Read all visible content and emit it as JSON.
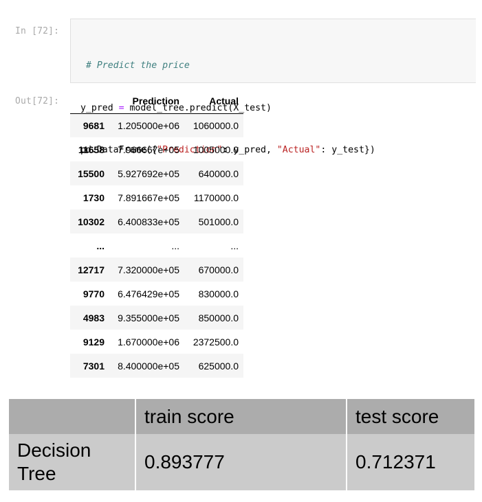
{
  "input_prompt": "In [72]:",
  "output_prompt": "Out[72]:",
  "code": {
    "comment": "# Predict the price",
    "line2": {
      "a": "y_pred ",
      "op": "=",
      "b": " model_tree.predict(X_test)"
    },
    "line3": {
      "a": "pd.DataFrame({",
      "s1": "\"Prediction\"",
      "b": ": y_pred, ",
      "s2": "\"Actual\"",
      "c": ": y_test})"
    }
  },
  "dataframe": {
    "columns": [
      "",
      "Prediction",
      "Actual"
    ],
    "rows": [
      {
        "index": "9681",
        "prediction": "1.205000e+06",
        "actual": "1060000.0"
      },
      {
        "index": "11658",
        "prediction": "7.966667e+05",
        "actual": "1005000.0"
      },
      {
        "index": "15500",
        "prediction": "5.927692e+05",
        "actual": "640000.0"
      },
      {
        "index": "1730",
        "prediction": "7.891667e+05",
        "actual": "1170000.0"
      },
      {
        "index": "10302",
        "prediction": "6.400833e+05",
        "actual": "501000.0"
      },
      {
        "index": "...",
        "prediction": "...",
        "actual": "..."
      },
      {
        "index": "12717",
        "prediction": "7.320000e+05",
        "actual": "670000.0"
      },
      {
        "index": "9770",
        "prediction": "6.476429e+05",
        "actual": "830000.0"
      },
      {
        "index": "4983",
        "prediction": "9.355000e+05",
        "actual": "850000.0"
      },
      {
        "index": "9129",
        "prediction": "1.670000e+06",
        "actual": "2372500.0"
      },
      {
        "index": "7301",
        "prediction": "8.400000e+05",
        "actual": "625000.0"
      }
    ]
  },
  "score_table": {
    "headers": [
      "",
      "train score",
      "test score"
    ],
    "model": "Decision Tree",
    "train": "0.893777",
    "test": "0.712371"
  },
  "colors": {
    "code_bg": "#f7f7f7",
    "comment": "#408080",
    "operator": "#aa22ff",
    "string": "#ba2121",
    "score_header_bg": "#acacac",
    "score_body_bg": "#cbcbcb"
  }
}
